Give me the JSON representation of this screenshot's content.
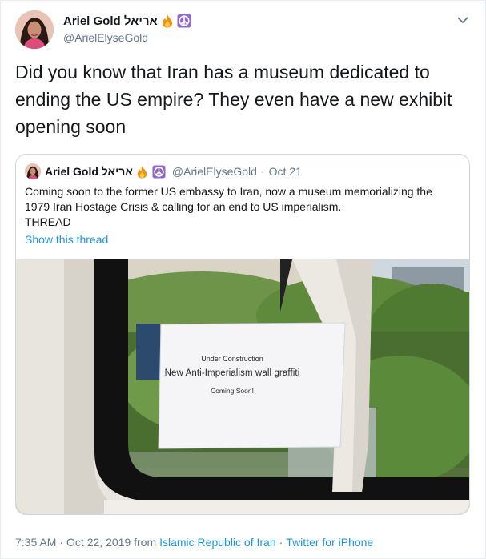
{
  "author": {
    "name": "Ariel Gold אריאל",
    "emoji_fire": "fire-icon",
    "emoji_peace": "peace-icon",
    "handle": "@ArielElyseGold"
  },
  "tweet": {
    "line1": "Did you know that Iran has a museum dedicated to",
    "line2": "ending the US empire? They even have a new exhibit",
    "line3": "opening soon"
  },
  "quoted": {
    "name": "Ariel Gold אריאל",
    "handle": "@ArielElyseGold",
    "dot": "·",
    "date": "Oct 21",
    "line1": "Coming soon to the former US embassy to Iran, now a museum memorializing the",
    "line2": "1979 Iran Hostage Crisis & calling for an end to US imperialism.",
    "line3": "THREAD",
    "show_thread": "Show this thread",
    "photo_sign": {
      "line1": "Under Construction",
      "line2": "New Anti-Imperialism wall graffiti",
      "line3": "Coming Soon!"
    }
  },
  "footer": {
    "time": "7:35 AM",
    "dot1": "·",
    "date": "Oct 22, 2019 from",
    "location": "Islamic Republic of Iran",
    "dot2": "·",
    "source": "Twitter for iPhone"
  },
  "colors": {
    "link": "#1b95e0",
    "secondary": "#657786",
    "border": "#ccd6dd"
  }
}
